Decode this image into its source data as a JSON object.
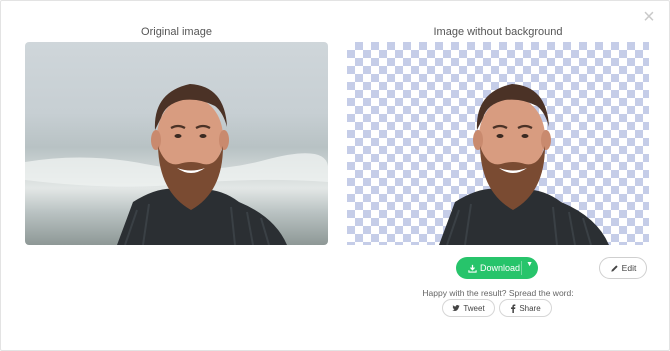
{
  "dialog": {
    "close_glyph": "×"
  },
  "panels": {
    "original": {
      "title": "Original image"
    },
    "removed": {
      "title": "Image without background"
    }
  },
  "actions": {
    "download_label": "Download",
    "edit_label": "Edit",
    "spread_text": "Happy with the result? Spread the word:",
    "tweet_label": "Tweet",
    "share_label": "Share"
  },
  "colors": {
    "accent_green": "#27c46b",
    "checker": "#c5cde8"
  },
  "icons": {
    "close": "close-icon",
    "download": "download-icon",
    "caret": "chevron-down-icon",
    "edit": "pencil-icon",
    "tweet": "twitter-icon",
    "share": "facebook-icon"
  }
}
